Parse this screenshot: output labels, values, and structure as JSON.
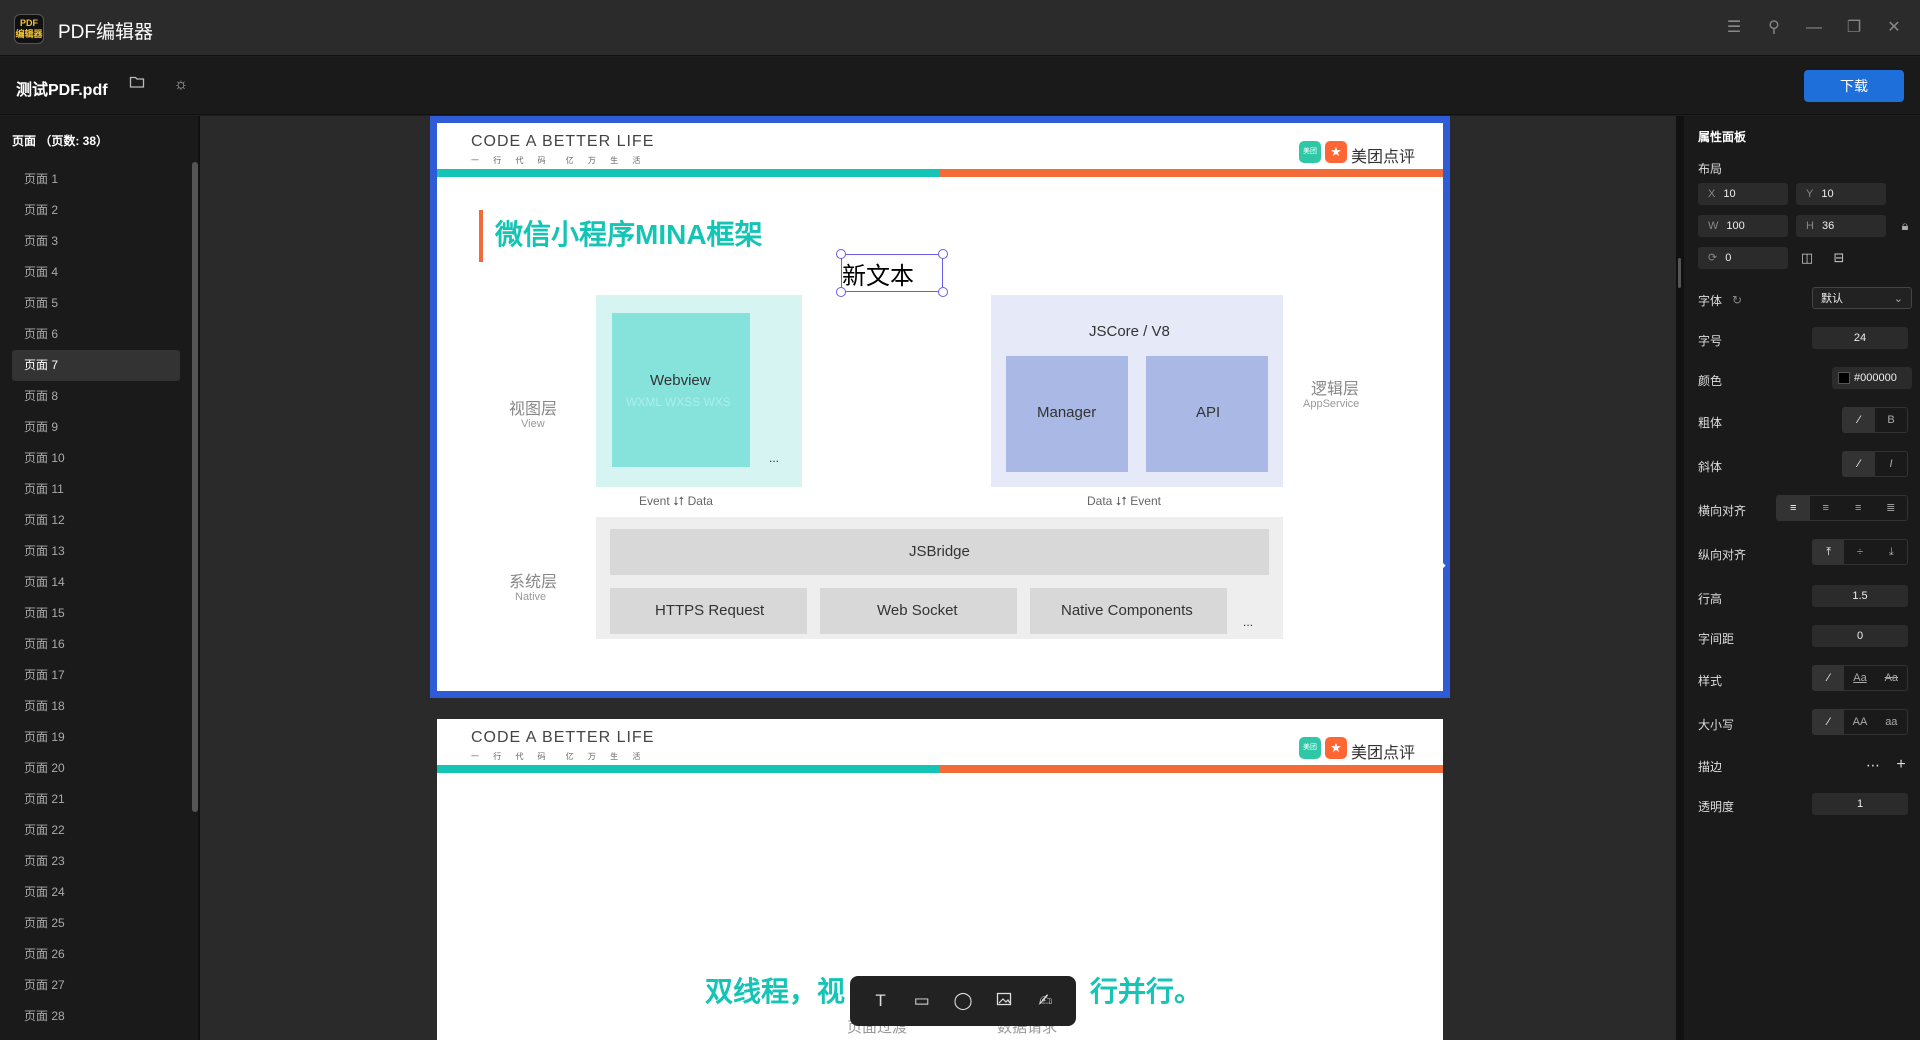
{
  "app": {
    "logo_text": "PDF\n编辑器",
    "title": "PDF编辑器"
  },
  "toolbar": {
    "file_name": "测试PDF.pdf",
    "download_label": "下载"
  },
  "sidebar": {
    "header": "页面 （页数: 38）",
    "active_index": 6,
    "pages": [
      "页面 1",
      "页面 2",
      "页面 3",
      "页面 4",
      "页面 5",
      "页面 6",
      "页面 7",
      "页面 8",
      "页面 9",
      "页面 10",
      "页面 11",
      "页面 12",
      "页面 13",
      "页面 14",
      "页面 15",
      "页面 16",
      "页面 17",
      "页面 18",
      "页面 19",
      "页面 20",
      "页面 21",
      "页面 22",
      "页面 23",
      "页面 24",
      "页面 25",
      "页面 26",
      "页面 27",
      "页面 28"
    ]
  },
  "slide1": {
    "header_title": "CODE A BETTER LIFE",
    "header_sub": "一 行 代 码　亿 万 生 活",
    "brand_icon": "美团",
    "brand_text": "美团点评",
    "heading": "微信小程序MINA框架",
    "new_text": "新文本",
    "view_layer": "视图层",
    "view_layer_en": "View",
    "logic_layer": "逻辑层",
    "logic_layer_en": "AppService",
    "system_layer": "系统层",
    "system_layer_en": "Native",
    "webview": "Webview",
    "webview_sub": "WXML WXSS WXS",
    "ellipsis": "...",
    "jscore": "JSCore / V8",
    "manager": "Manager",
    "api": "API",
    "left_arrow": "Event ⭣⭡ Data",
    "right_arrow": "Data ⭣⭡ Event",
    "jsbridge": "JSBridge",
    "https": "HTTPS Request",
    "websocket": "Web Socket",
    "native_components": "Native Components"
  },
  "slide2": {
    "header_title": "CODE A BETTER LIFE",
    "header_sub": "一 行 代 码　亿 万 生 活",
    "brand_icon": "美团",
    "brand_text": "美团点评",
    "bottom_left": "双线程，视",
    "bottom_right": "行并行。",
    "under_left": "页面过渡",
    "under_right": "数据请求"
  },
  "props": {
    "title": "属性面板",
    "layout_label": "布局",
    "x": "10",
    "y": "10",
    "w": "100",
    "h": "36",
    "rotate": "0",
    "font_label": "字体",
    "font_value": "默认",
    "size_label": "字号",
    "size_value": "24",
    "color_label": "颜色",
    "color_value": "#000000",
    "bold_label": "粗体",
    "italic_label": "斜体",
    "halign_label": "横向对齐",
    "valign_label": "纵向对齐",
    "lineheight_label": "行高",
    "lineheight_value": "1.5",
    "spacing_label": "字间距",
    "spacing_value": "0",
    "style_label": "样式",
    "case_label": "大小写",
    "stroke_label": "描边",
    "opacity_label": "透明度",
    "opacity_value": "1"
  },
  "colors": {
    "accent": "#1e6fd9",
    "selection": "#2f5bd6",
    "teal": "#14c4b5",
    "orange": "#f26c3a"
  }
}
